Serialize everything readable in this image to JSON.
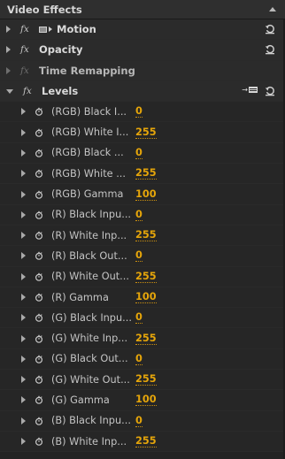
{
  "panel": {
    "title": "Video Effects"
  },
  "effects": [
    {
      "label": "Motion",
      "badge": "fx",
      "enabled": true,
      "expanded": false
    },
    {
      "label": "Opacity",
      "badge": "fx",
      "enabled": true,
      "expanded": false
    },
    {
      "label": "Time Remapping",
      "badge": "fx",
      "enabled": false,
      "expanded": false
    },
    {
      "label": "Levels",
      "badge": "fx",
      "enabled": true,
      "expanded": true
    }
  ],
  "levels_properties": [
    {
      "label": "(RGB) Black I...",
      "value": "0"
    },
    {
      "label": "(RGB) White I...",
      "value": "255"
    },
    {
      "label": "(RGB) Black ...",
      "value": "0"
    },
    {
      "label": "(RGB) White ...",
      "value": "255"
    },
    {
      "label": "(RGB) Gamma",
      "value": "100"
    },
    {
      "label": "(R) Black Inpu...",
      "value": "0"
    },
    {
      "label": "(R) White Inp...",
      "value": "255"
    },
    {
      "label": "(R) Black Out...",
      "value": "0"
    },
    {
      "label": "(R) White Out...",
      "value": "255"
    },
    {
      "label": "(R) Gamma",
      "value": "100"
    },
    {
      "label": "(G) Black Inpu...",
      "value": "0"
    },
    {
      "label": "(G) White Inp...",
      "value": "255"
    },
    {
      "label": "(G) Black Out...",
      "value": "0"
    },
    {
      "label": "(G) White Out...",
      "value": "255"
    },
    {
      "label": "(G) Gamma",
      "value": "100"
    },
    {
      "label": "(B) Black Inpu...",
      "value": "0"
    },
    {
      "label": "(B) White Inp...",
      "value": "255"
    }
  ],
  "colors": {
    "accent_value": "#e5a50a",
    "background": "#232323"
  },
  "icons": {
    "collapse": "chevron-up-icon",
    "reset": "reset-icon",
    "stopwatch": "stopwatch-icon",
    "motion": "motion-icon",
    "flyout": "levels-settings-icon"
  }
}
